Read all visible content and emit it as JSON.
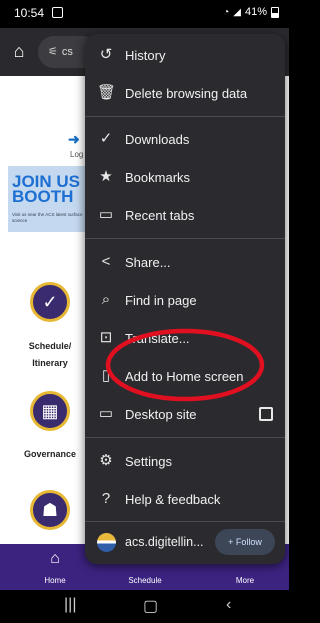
{
  "status_bar": {
    "time": "10:54",
    "battery": "41%"
  },
  "browser": {
    "url_text": "cs"
  },
  "page": {
    "login_text": "Log",
    "banner": {
      "title_line1": "JOIN US",
      "title_line2": "BOOTH",
      "subtitle": "Visit us near the ACS latest surface science"
    },
    "tiles": [
      {
        "label_line1": "Schedule/",
        "label_line2": "Itinerary"
      },
      {
        "label_line1": "Governance",
        "label_line2": ""
      },
      {
        "label_line1": "",
        "label_line2": ""
      }
    ]
  },
  "bottom_nav": [
    {
      "label": "Home",
      "icon": "home-icon"
    },
    {
      "label": "Schedule",
      "icon": "calendar-icon"
    },
    {
      "label": "More",
      "icon": "menu-icon"
    }
  ],
  "menu": {
    "items": [
      {
        "label": "History",
        "icon": "history-icon"
      },
      {
        "label": "Delete browsing data",
        "icon": "trash-icon"
      },
      {
        "label": "Downloads",
        "icon": "downloads-icon"
      },
      {
        "label": "Bookmarks",
        "icon": "star-icon"
      },
      {
        "label": "Recent tabs",
        "icon": "recent-tabs-icon"
      },
      {
        "label": "Share...",
        "icon": "share-icon"
      },
      {
        "label": "Find in page",
        "icon": "find-icon"
      },
      {
        "label": "Translate...",
        "icon": "translate-icon"
      },
      {
        "label": "Add to Home screen",
        "icon": "add-to-home-icon"
      },
      {
        "label": "Desktop site",
        "icon": "desktop-icon"
      },
      {
        "label": "Settings",
        "icon": "gear-icon"
      },
      {
        "label": "Help & feedback",
        "icon": "help-icon"
      }
    ],
    "site": {
      "label": "acs.digitellin...",
      "follow_label": "+ Follow"
    },
    "desktop_site_checked": false,
    "highlight_color": "#e01020"
  }
}
